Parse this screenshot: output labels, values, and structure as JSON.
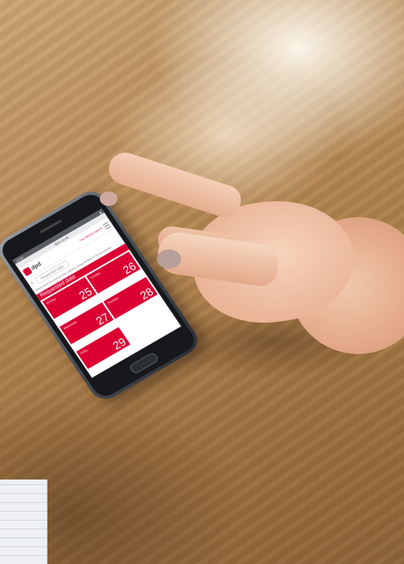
{
  "browser": {
    "url": "dpd.co.uk",
    "status_time": "12:50"
  },
  "app": {
    "brand": "dpd",
    "header_link": "Your delivery options",
    "nav_title": "Requested date"
  },
  "section": {
    "title": "Requested date",
    "instructions": "Please select your preferred day. A delivery charge will apply for the day selected."
  },
  "days": [
    {
      "name": "Monday",
      "date": "25"
    },
    {
      "name": "Tuesday",
      "date": "26"
    },
    {
      "name": "Wednesday",
      "date": "27"
    },
    {
      "name": "Thursday",
      "date": "28"
    },
    {
      "name": "Friday",
      "date": "29"
    }
  ],
  "colors": {
    "brand_red": "#dc0032",
    "wood": "#b38652"
  }
}
